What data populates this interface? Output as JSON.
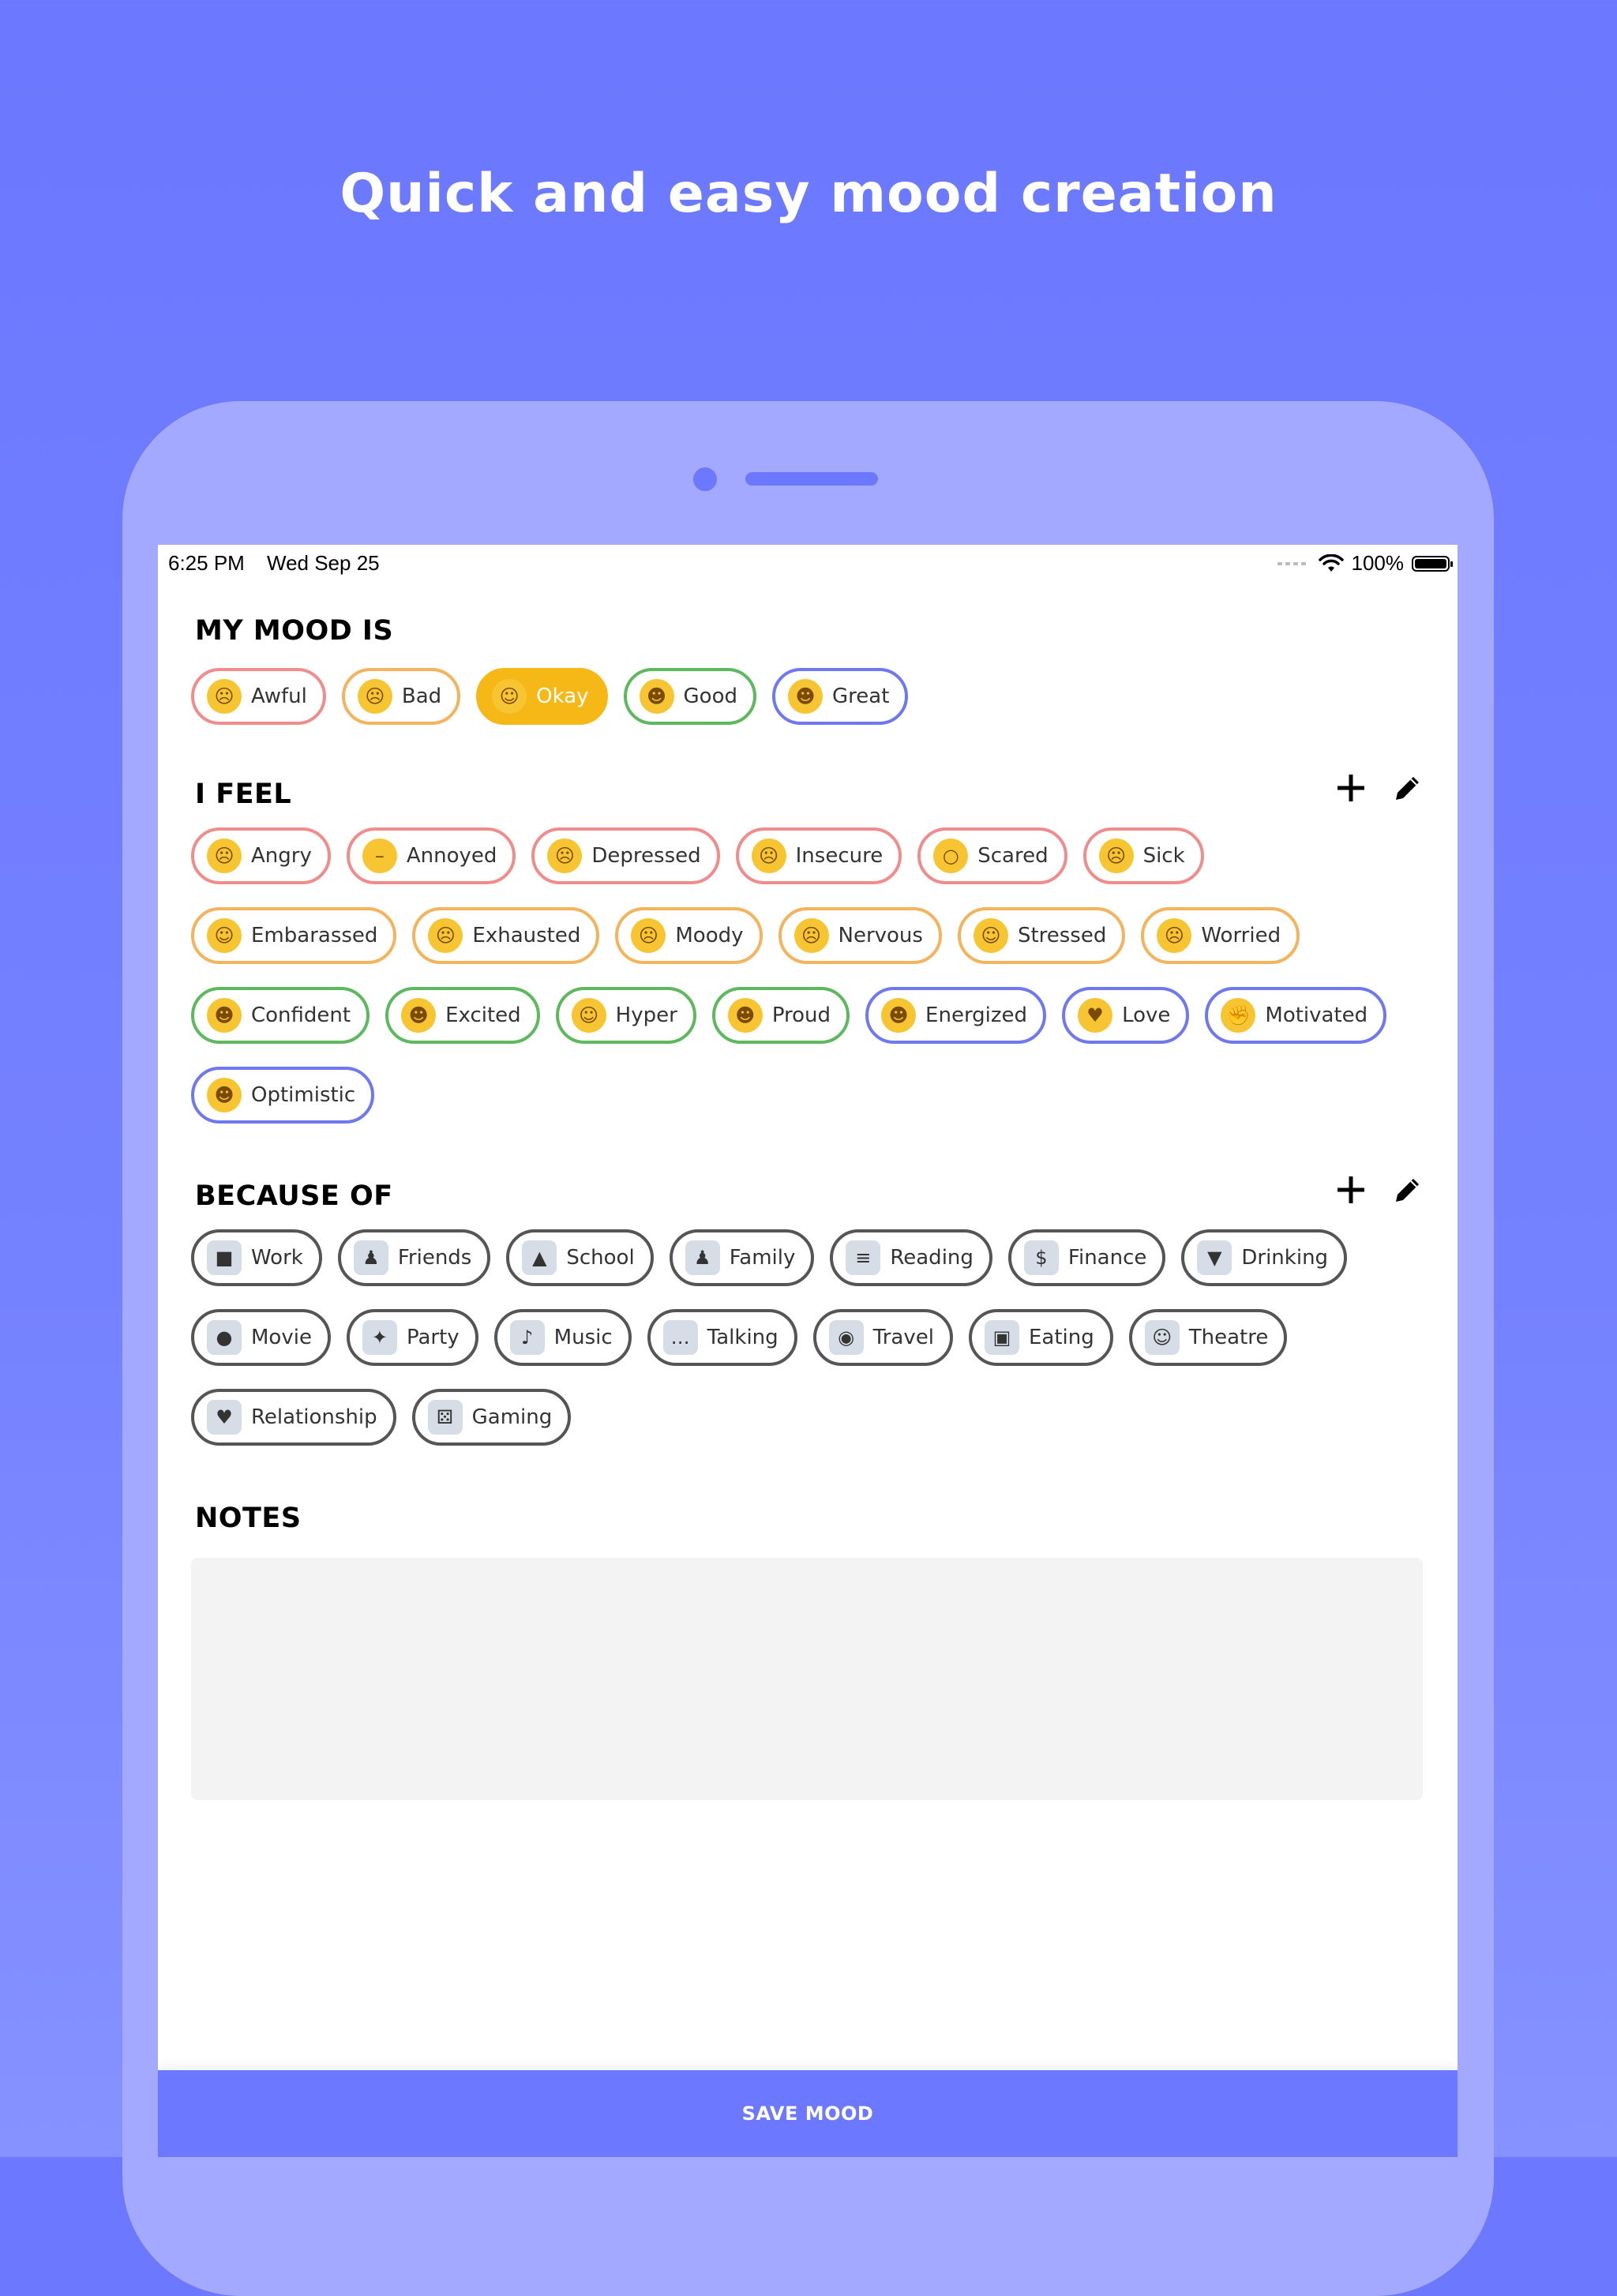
{
  "headline": "Quick and easy mood creation",
  "status_bar": {
    "time": "6:25 PM",
    "date": "Wed Sep 25",
    "battery": "100%"
  },
  "mood": {
    "title": "MY MOOD IS",
    "options": [
      {
        "label": "Awful",
        "emoji": "sad-face",
        "glyph": "☹",
        "color": "#f08d8c",
        "selected": false
      },
      {
        "label": "Bad",
        "emoji": "frown-face",
        "glyph": "☹",
        "color": "#f4b35d",
        "selected": false
      },
      {
        "label": "Okay",
        "emoji": "slight-smile-face",
        "glyph": "☺",
        "color": "#f6b817",
        "selected": true
      },
      {
        "label": "Good",
        "emoji": "grin-face",
        "glyph": "☻",
        "color": "#5eb85e",
        "selected": false
      },
      {
        "label": "Great",
        "emoji": "beaming-face",
        "glyph": "☻",
        "color": "#7078f0",
        "selected": false
      }
    ]
  },
  "feelings": {
    "title": "I FEEL",
    "rows": [
      [
        {
          "label": "Angry",
          "emoji": "angry-face",
          "glyph": "☹",
          "border": "red"
        },
        {
          "label": "Annoyed",
          "emoji": "expressionless-face",
          "glyph": "–",
          "border": "red"
        },
        {
          "label": "Depressed",
          "emoji": "pensive-face",
          "glyph": "☹",
          "border": "red"
        },
        {
          "label": "Insecure",
          "emoji": "confused-face",
          "glyph": "☹",
          "border": "red"
        },
        {
          "label": "Scared",
          "emoji": "screaming-face",
          "glyph": "○",
          "border": "red"
        },
        {
          "label": "Sick",
          "emoji": "woozy-face",
          "glyph": "☹",
          "border": "red"
        }
      ],
      [
        {
          "label": "Embarassed",
          "emoji": "grimace-face",
          "glyph": "☺",
          "border": "orange"
        },
        {
          "label": "Exhausted",
          "emoji": "tired-face",
          "glyph": "☹",
          "border": "orange"
        },
        {
          "label": "Moody",
          "emoji": "crying-face",
          "glyph": "☹",
          "border": "orange"
        },
        {
          "label": "Nervous",
          "emoji": "anxious-face",
          "glyph": "☹",
          "border": "orange"
        },
        {
          "label": "Stressed",
          "emoji": "grimace-face",
          "glyph": "☺",
          "border": "orange"
        },
        {
          "label": "Worried",
          "emoji": "worried-face",
          "glyph": "☹",
          "border": "orange"
        }
      ],
      [
        {
          "label": "Confident",
          "emoji": "sunglasses-face",
          "glyph": "☻",
          "border": "green"
        },
        {
          "label": "Excited",
          "emoji": "beaming-face",
          "glyph": "☻",
          "border": "green"
        },
        {
          "label": "Hyper",
          "emoji": "zany-face",
          "glyph": "☺",
          "border": "green"
        },
        {
          "label": "Proud",
          "emoji": "beaming-face",
          "glyph": "☻",
          "border": "green"
        },
        {
          "label": "Energized",
          "emoji": "grin-face",
          "glyph": "☻",
          "border": "blue"
        },
        {
          "label": "Love",
          "emoji": "heart-eyes-face",
          "glyph": "♥",
          "border": "blue"
        },
        {
          "label": "Motivated",
          "emoji": "flexed-bicep",
          "glyph": "✊",
          "border": "blue"
        }
      ],
      [
        {
          "label": "Optimistic",
          "emoji": "beaming-face",
          "glyph": "☻",
          "border": "blue"
        }
      ]
    ]
  },
  "reasons": {
    "title": "BECAUSE OF",
    "rows": [
      [
        {
          "label": "Work",
          "emoji": "briefcase",
          "glyph": "■"
        },
        {
          "label": "Friends",
          "emoji": "two-people",
          "glyph": "♟"
        },
        {
          "label": "School",
          "emoji": "school-building",
          "glyph": "▲"
        },
        {
          "label": "Family",
          "emoji": "family",
          "glyph": "♟"
        },
        {
          "label": "Reading",
          "emoji": "books",
          "glyph": "≡"
        },
        {
          "label": "Finance",
          "emoji": "money-bill",
          "glyph": "$"
        },
        {
          "label": "Drinking",
          "emoji": "tropical-drink",
          "glyph": "▼"
        }
      ],
      [
        {
          "label": "Movie",
          "emoji": "movie-camera",
          "glyph": "●"
        },
        {
          "label": "Party",
          "emoji": "party-popper",
          "glyph": "✦"
        },
        {
          "label": "Music",
          "emoji": "music-note",
          "glyph": "♪"
        },
        {
          "label": "Talking",
          "emoji": "speech-bubble",
          "glyph": "…"
        },
        {
          "label": "Travel",
          "emoji": "globe",
          "glyph": "◉"
        },
        {
          "label": "Eating",
          "emoji": "takeout-box",
          "glyph": "▣"
        },
        {
          "label": "Theatre",
          "emoji": "theatre-masks",
          "glyph": "☺"
        }
      ],
      [
        {
          "label": "Relationship",
          "emoji": "couple-kiss",
          "glyph": "♥"
        },
        {
          "label": "Gaming",
          "emoji": "game-die",
          "glyph": "⚄"
        }
      ]
    ]
  },
  "notes": {
    "title": "NOTES",
    "value": ""
  },
  "save_label": "SAVE MOOD",
  "colors": {
    "background": "#6b78ff",
    "accent": "#6b78ff",
    "selected": "#f6b817",
    "red": "#f08d8c",
    "orange": "#f4b35d",
    "green": "#5eb85e",
    "blue": "#7078f0",
    "dark": "#555555"
  }
}
